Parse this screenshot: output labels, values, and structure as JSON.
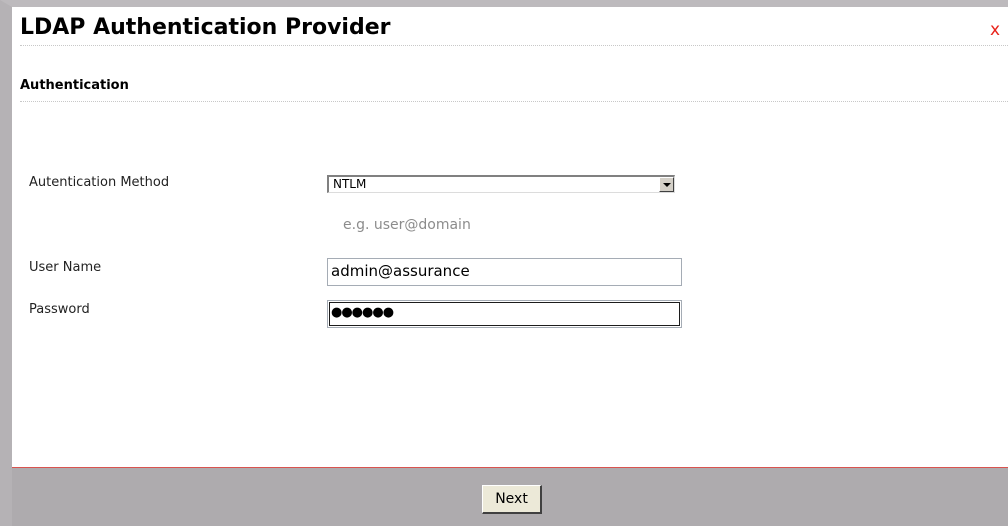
{
  "dialog": {
    "title": "LDAP Authentication Provider",
    "close_label": "x"
  },
  "section": {
    "title": "Authentication"
  },
  "form": {
    "method_label": "Autentication Method",
    "method_value": "NTLM",
    "hint": "e.g. user@domain",
    "username_label": "User Name",
    "username_value": "admin@assurance",
    "password_label": "Password",
    "password_masked": "●●●●●●"
  },
  "footer": {
    "next_label": "Next"
  },
  "colors": {
    "close": "#e8231b",
    "footer_bg": "#aeabae",
    "footer_border": "#d9534f"
  },
  "icons": {
    "close": "close-icon",
    "dropdown": "chevron-down-icon"
  }
}
